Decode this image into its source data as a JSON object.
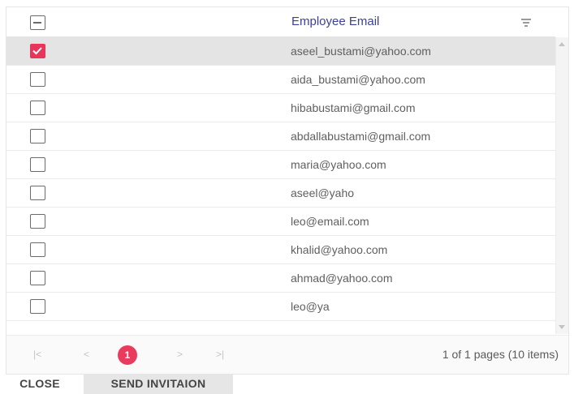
{
  "table": {
    "column_header": "Employee Email",
    "rows": [
      {
        "email": "aseel_bustami@yahoo.com",
        "selected": true
      },
      {
        "email": "aida_bustami@yahoo.com",
        "selected": false
      },
      {
        "email": "hibabustami@gmail.com",
        "selected": false
      },
      {
        "email": "abdallabustami@gmail.com",
        "selected": false
      },
      {
        "email": "maria@yahoo.com",
        "selected": false
      },
      {
        "email": "aseel@yaho",
        "selected": false
      },
      {
        "email": "leo@email.com",
        "selected": false
      },
      {
        "email": "khalid@yahoo.com",
        "selected": false
      },
      {
        "email": "ahmad@yahoo.com",
        "selected": false
      },
      {
        "email": "leo@ya",
        "selected": false
      }
    ]
  },
  "pager": {
    "first_label": "|<",
    "prev_label": "<",
    "current_page": "1",
    "next_label": ">",
    "last_label": ">|",
    "info": "1 of 1 pages (10 items)"
  },
  "buttons": {
    "close": "CLOSE",
    "send": "SEND INVITAION"
  },
  "colors": {
    "accent": "#ea3a5d",
    "header_text": "#3b3f99",
    "selected_row": "#e4e4e4"
  }
}
